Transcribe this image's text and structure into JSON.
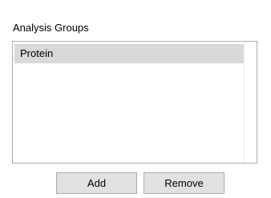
{
  "panel": {
    "title": "Analysis Groups"
  },
  "list": {
    "items": [
      {
        "label": "Protein",
        "selected": true
      }
    ]
  },
  "buttons": {
    "add_label": "Add",
    "remove_label": "Remove"
  },
  "colors": {
    "selection_bg": "#d9d9d9",
    "button_bg": "#e1e1e1",
    "border": "#adadad"
  }
}
